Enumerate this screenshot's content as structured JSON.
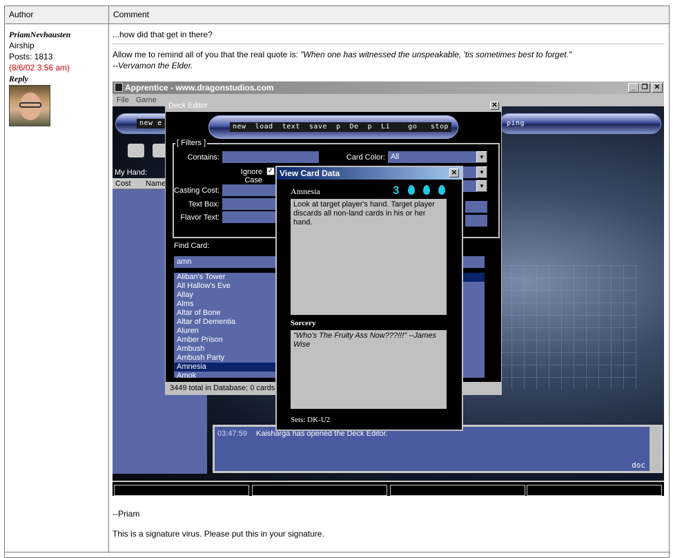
{
  "table": {
    "author_header": "Author",
    "comment_header": "Comment"
  },
  "author": {
    "name": "PriamNevhausten",
    "location": "Airship",
    "posts": "Posts: 1813",
    "date": "(8/6/02 3:56 am)",
    "reply": "Reply"
  },
  "post": {
    "line1": "...how did that get in there?",
    "quote_intro": "Allow me to remind all of you that the real quote is: ",
    "quote": "\"When one has witnessed the unspeakable, 'tis sometimes best to forget.\"",
    "quote_attr": "--Vervamon the Elder.",
    "signoff": "--Priam",
    "signature": "This is a signature virus. Please put this in your signature."
  },
  "app": {
    "title": "Apprentice - www.dragonstudios.com",
    "menu": [
      "File",
      "Game"
    ],
    "top_pill_left": "new e",
    "top_pill_right": "ping",
    "my_hand_label": "My Hand:",
    "hand_cols": [
      "Cost",
      "Name"
    ],
    "log_time": "03:47:59",
    "log_text": "Kaisharga has opened the Deck Editor.",
    "log_tail": "doc"
  },
  "deck_editor": {
    "title": "Deck Editor",
    "toolbar": "new  load  text  save  p  De  p  Li    go   stop",
    "filters_label": "[ Filters ]",
    "contains_label": "Contains:",
    "ignore_case_label": "Ignore Case",
    "card_color_label": "Card Color:",
    "card_color_value": "All",
    "casting_cost_label": "Casting Cost:",
    "text_box_label": "Text Box:",
    "flavor_text_label": "Flavor Text:",
    "find_card_label": "Find Card:",
    "find_card_value": "amn",
    "cards": [
      "Aliban's Tower",
      "All Hallow's Eve",
      "Allay",
      "Alms",
      "Altar of Bone",
      "Altar of Dementia",
      "Aluren",
      "Amber Prison",
      "Ambush",
      "Ambush Party",
      "Amnesia",
      "Amok"
    ],
    "selected_card": "Amnesia",
    "status": "3449 total in Database;  0 cards"
  },
  "card_view": {
    "title": "View Card Data",
    "card_name": "Amnesia",
    "cost": "3",
    "rules_text": "Look at target player's hand. Target player discards all non-land cards in his or her hand.",
    "type": "Sorcery",
    "flavor": "\"Who's The Fruity Ass Now???!!!\" --James Wise",
    "sets": "Sets: DK-U2",
    "mana_color": "#22c8e0"
  }
}
